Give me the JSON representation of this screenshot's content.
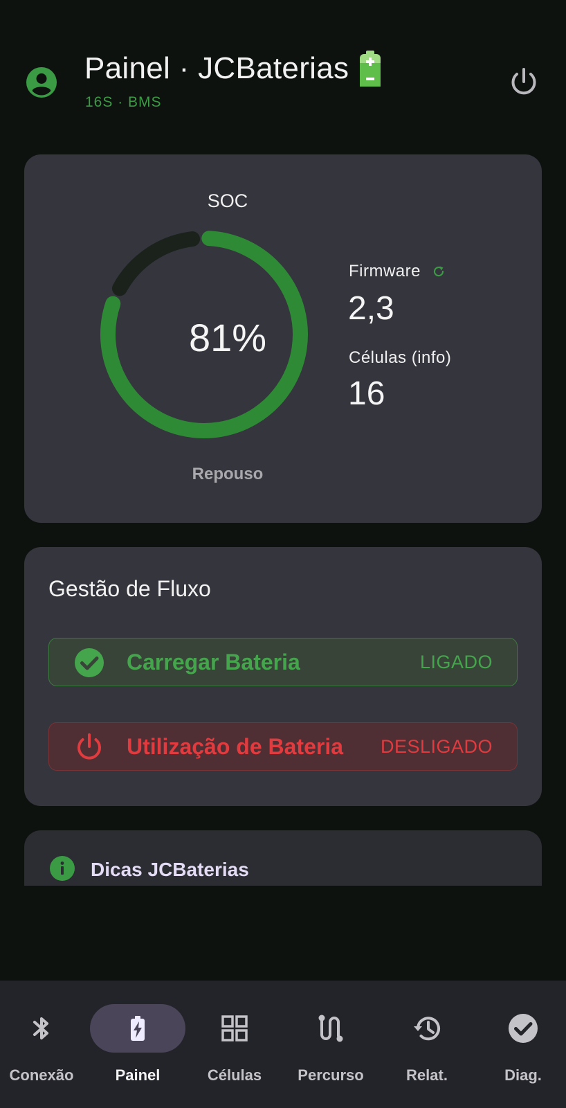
{
  "header": {
    "title": "Painel · JCBaterias",
    "subtitle": "16S · BMS"
  },
  "soc_card": {
    "label": "SOC",
    "value_text": "81%",
    "soc_fraction": 0.81,
    "state": "Repouso",
    "firmware_label": "Firmware",
    "firmware_value": "2,3",
    "cells_label": "Células (info)",
    "cells_value": "16"
  },
  "flow_card": {
    "title": "Gestão de Fluxo",
    "charge_label": "Carregar Bateria",
    "charge_status": "LIGADO",
    "use_label": "Utilização de Bateria",
    "use_status": "DESLIGADO"
  },
  "tips_card": {
    "title": "Dicas JCBaterias"
  },
  "nav": {
    "items": [
      {
        "label": "Conexão",
        "icon": "bluetooth-icon"
      },
      {
        "label": "Painel",
        "icon": "battery-charging-icon"
      },
      {
        "label": "Células",
        "icon": "grid-icon"
      },
      {
        "label": "Percurso",
        "icon": "route-icon"
      },
      {
        "label": "Relat.",
        "icon": "history-icon"
      },
      {
        "label": "Diag.",
        "icon": "check-circle-icon"
      }
    ],
    "active_index": 1
  },
  "colors": {
    "background": "#0e120f",
    "card": "#35353d",
    "accent_green": "#2e8a35",
    "on_text_green": "#45a54c",
    "off_text_red": "#e03b3f",
    "gauge_track": "#1b221c",
    "nav_background": "#23232a",
    "nav_active_pill": "#4a4558"
  }
}
